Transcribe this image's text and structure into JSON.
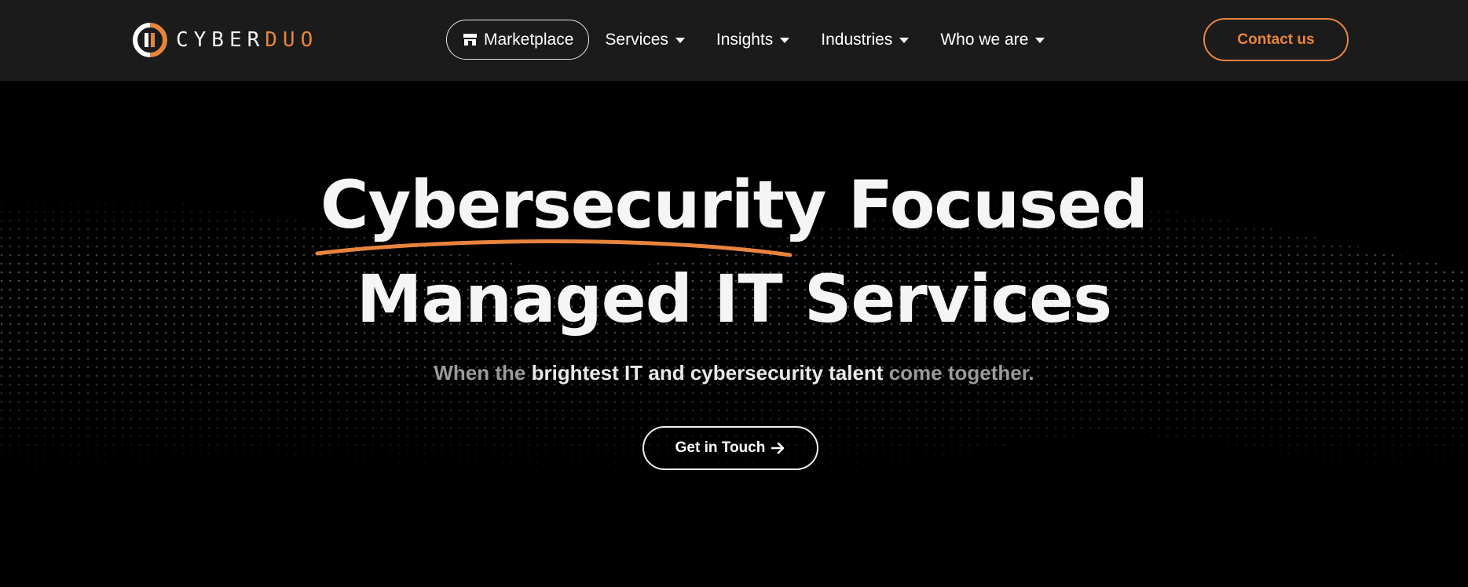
{
  "brand": {
    "logo_part1": "CYBER",
    "logo_part2": "DUO",
    "accent_color": "#e8843d",
    "nav_background": "#1b1b1b"
  },
  "nav": {
    "marketplace": {
      "label": "Marketplace",
      "icon": "store-icon"
    },
    "items": [
      {
        "label": "Services",
        "icon": "caret-down-icon"
      },
      {
        "label": "Insights",
        "icon": "caret-down-icon"
      },
      {
        "label": "Industries",
        "icon": "caret-down-icon"
      },
      {
        "label": "Who we are",
        "icon": "caret-down-icon"
      }
    ],
    "contact_label": "Contact us"
  },
  "hero": {
    "headline_highlight": "Cybersecurity",
    "headline_rest": " Focused",
    "headline_line2": "Managed IT Services",
    "sub_before": "When the ",
    "sub_highlight": "brightest IT and cybersecurity talent",
    "sub_after": " come together.",
    "cta_label": "Get in Touch",
    "cta_icon": "arrow-right-icon"
  }
}
